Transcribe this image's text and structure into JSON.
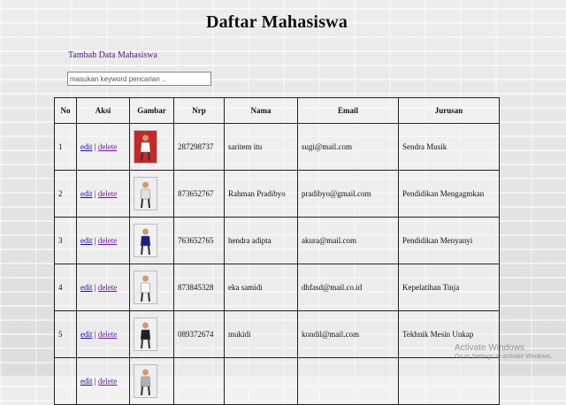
{
  "page": {
    "title": "Daftar Mahasiswa",
    "add_link": "Tambah Data Mahasiswa",
    "search_placeholder": "masukan keyword pencarian .."
  },
  "table": {
    "headers": [
      "No",
      "Aksi",
      "Gambar",
      "Nrp",
      "Nama",
      "Email",
      "Jurusan"
    ],
    "action_edit": "edit",
    "action_sep": "|",
    "action_delete": "delete",
    "rows": [
      {
        "no": "1",
        "image_icon": "photo-thumbnail-icon",
        "nrp": "287298737",
        "nama": "saritem itu",
        "email": "sugi@mail.com",
        "jurusan": "Sendra Musik"
      },
      {
        "no": "2",
        "image_icon": "photo-thumbnail-icon",
        "nrp": "873652767",
        "nama": "Rahman Pradibyo",
        "email": "pradibyo@gmail.com",
        "jurusan": "Pendidikan Mengagmkan"
      },
      {
        "no": "3",
        "image_icon": "photo-thumbnail-icon",
        "nrp": "763652765",
        "nama": "hendra adipta",
        "email": "akura@mail.com",
        "jurusan": "Pendidikan Menyanyi"
      },
      {
        "no": "4",
        "image_icon": "photo-thumbnail-icon",
        "nrp": "873845328",
        "nama": "eka samidi",
        "email": "dhfasd@mail.co.id",
        "jurusan": "Kepelatihan Tinja"
      },
      {
        "no": "5",
        "image_icon": "photo-thumbnail-icon",
        "nrp": "089372674",
        "nama": "mukidi",
        "email": "kondil@mail.com",
        "jurusan": "Tekhnik Mesin Unkap"
      },
      {
        "no": "",
        "image_icon": "photo-thumbnail-icon",
        "nrp": "",
        "nama": "",
        "email": "",
        "jurusan": ""
      }
    ]
  },
  "watermark": {
    "line1": "Activate Windows",
    "line2": "Go to Settings to activate Windows."
  },
  "colors": {
    "link": "#1a0dab",
    "add_link": "#4b1d7a",
    "table_border": "#222222"
  }
}
